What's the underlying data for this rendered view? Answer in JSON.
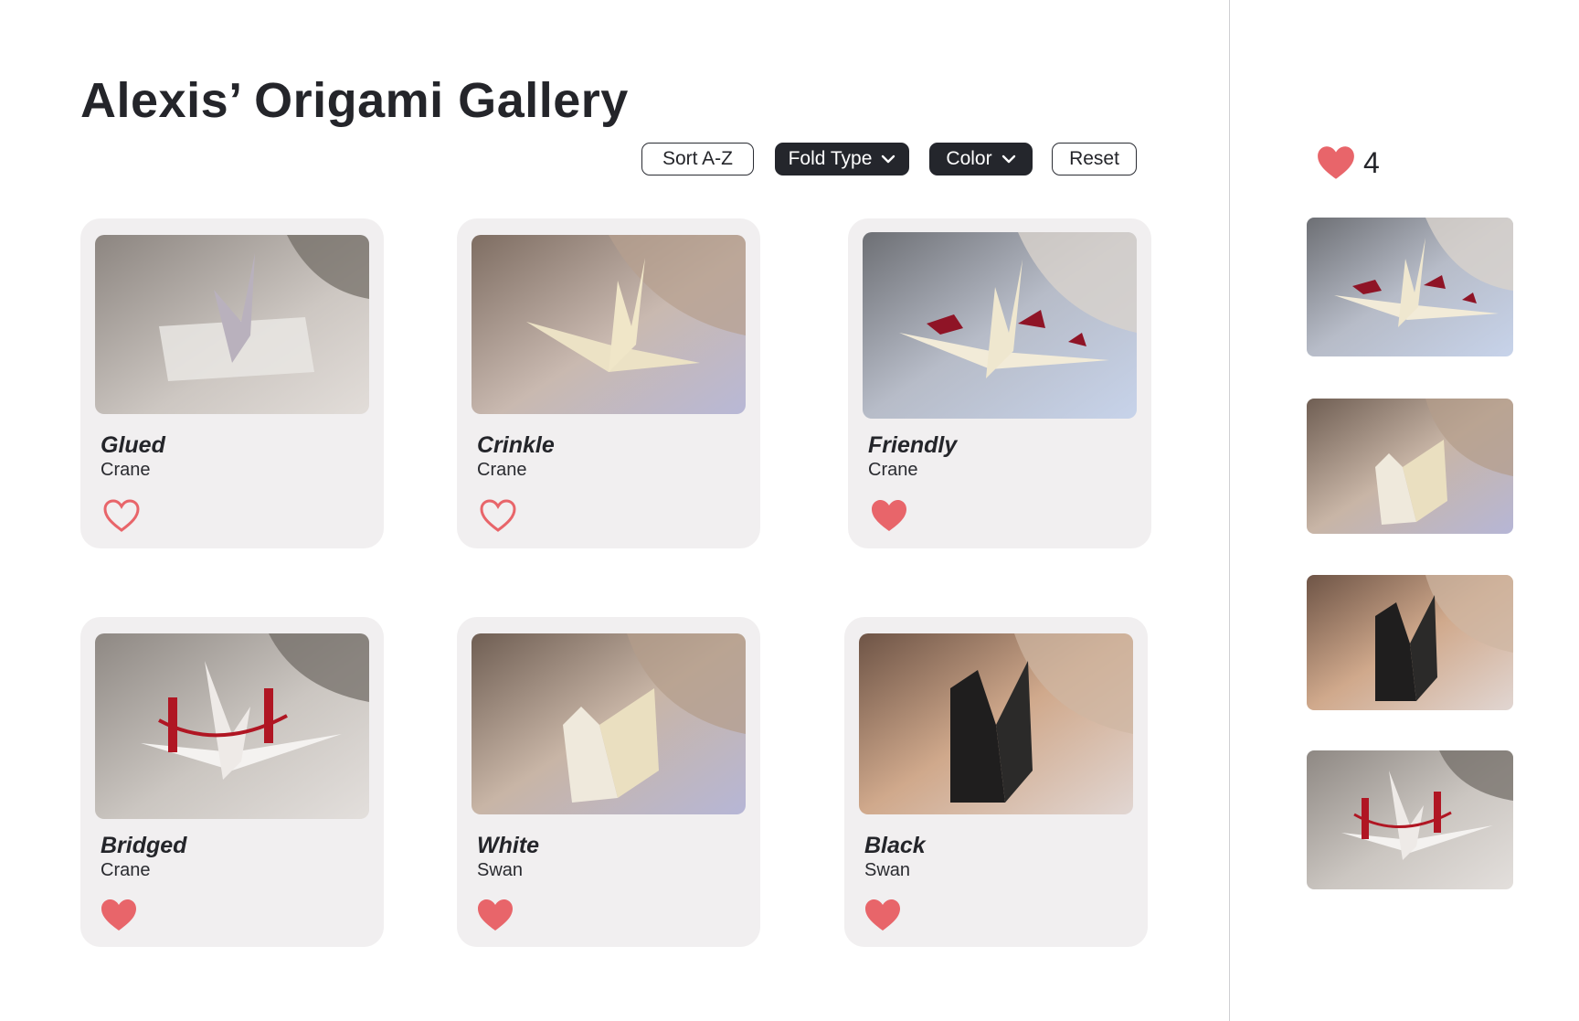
{
  "page": {
    "title": "Alexis’ Origami Gallery"
  },
  "toolbar": {
    "sort_label": "Sort A-Z",
    "fold_type_label": "Fold Type",
    "color_label": "Color",
    "reset_label": "Reset"
  },
  "colors": {
    "heart": "#e8656a",
    "card_bg": "#f1eff0",
    "dark_button": "#24262c"
  },
  "cards": [
    {
      "name": "Glued",
      "type": "Crane",
      "favorited": false,
      "icon": "heart-outline-icon"
    },
    {
      "name": "Crinkle",
      "type": "Crane",
      "favorited": false,
      "icon": "heart-outline-icon"
    },
    {
      "name": "Friendly",
      "type": "Crane",
      "favorited": true,
      "icon": "heart-filled-icon"
    },
    {
      "name": "Bridged",
      "type": "Crane",
      "favorited": true,
      "icon": "heart-filled-icon"
    },
    {
      "name": "White",
      "type": "Swan",
      "favorited": true,
      "icon": "heart-filled-icon"
    },
    {
      "name": "Black",
      "type": "Swan",
      "favorited": true,
      "icon": "heart-filled-icon"
    }
  ],
  "favorites": {
    "count": "4",
    "icon": "heart-filled-icon",
    "thumbnails": [
      "Friendly",
      "White",
      "Black",
      "Bridged"
    ]
  }
}
